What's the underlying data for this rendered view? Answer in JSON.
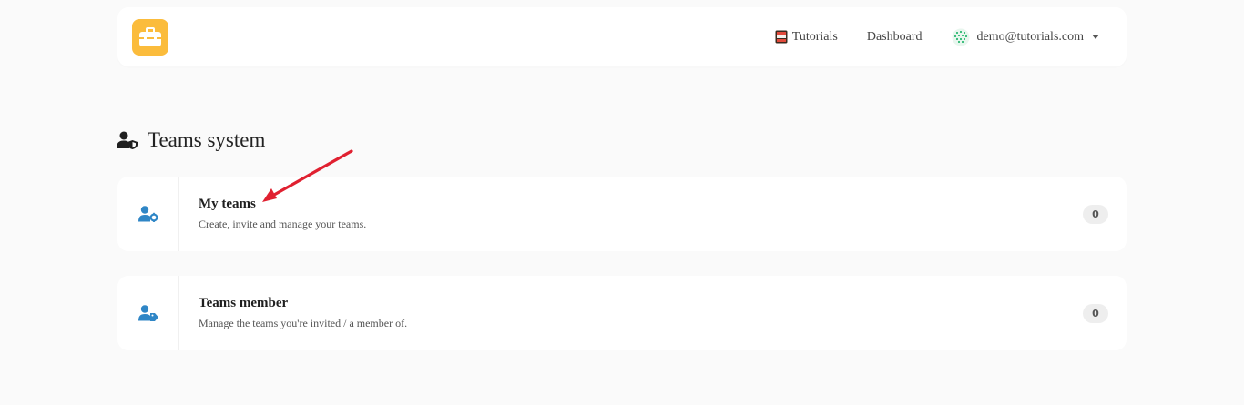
{
  "colors": {
    "accent": "#fbbc3c",
    "icon_blue": "#2f86c6",
    "arrow_red": "#e02030"
  },
  "nav": {
    "logo_icon": "toolbox-icon",
    "links": [
      {
        "label": "Tutorials",
        "icon": "book-icon"
      },
      {
        "label": "Dashboard"
      }
    ],
    "user": {
      "email": "demo@tutorials.com",
      "avatar_icon": "avatar",
      "caret_icon": "caret-down-icon"
    }
  },
  "section": {
    "title": "Teams system",
    "icon": "user-shield-icon"
  },
  "cards": [
    {
      "title": "My teams",
      "description": "Create, invite and manage your teams.",
      "count": "0",
      "icon": "user-cog-icon"
    },
    {
      "title": "Teams member",
      "description": "Manage the teams you're invited / a member of.",
      "count": "0",
      "icon": "user-tag-icon"
    }
  ]
}
